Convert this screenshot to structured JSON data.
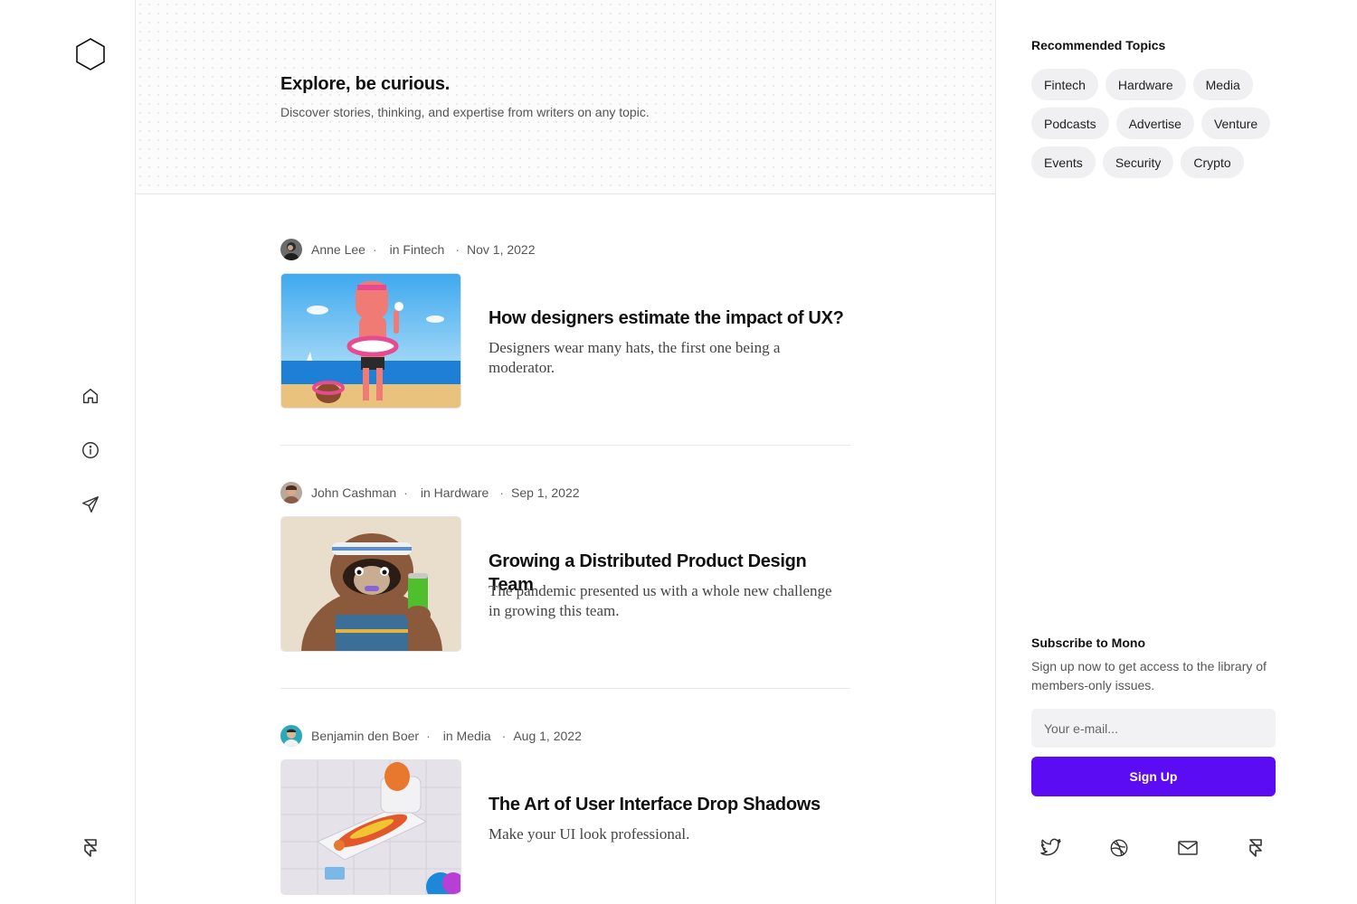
{
  "brand": {
    "logo_icon": "hexagon-icon"
  },
  "nav": [
    {
      "name": "home",
      "icon": "home-icon"
    },
    {
      "name": "about",
      "icon": "info-icon"
    },
    {
      "name": "send",
      "icon": "paper-plane-icon"
    }
  ],
  "footer_rail_icon": "framer-icon",
  "hero": {
    "title": "Explore, be curious.",
    "subtitle": "Discover stories, thinking, and expertise from writers on any topic."
  },
  "posts": [
    {
      "author": "Anne Lee",
      "topic": "in Fintech",
      "date": "Nov 1, 2022",
      "title": "How designers estimate the impact of UX?",
      "excerpt": "Designers wear many hats, the first one being a moderator."
    },
    {
      "author": "John Cashman",
      "topic": "in Hardware",
      "date": "Sep 1, 2022",
      "title": "Growing a Distributed Product Design Team",
      "excerpt": "The pandemic presented us with a whole new challenge in growing this team."
    },
    {
      "author": "Benjamin den Boer",
      "topic": "in Media",
      "date": "Aug 1, 2022",
      "title": "The Art of User Interface Drop Shadows",
      "excerpt": "Make your UI look professional."
    }
  ],
  "sep": "·",
  "topics": {
    "heading": "Recommended Topics",
    "items": [
      "Fintech",
      "Hardware",
      "Media",
      "Podcasts",
      "Advertise",
      "Venture",
      "Events",
      "Security",
      "Crypto"
    ]
  },
  "subscribe": {
    "heading": "Subscribe to Mono",
    "text": "Sign up now to get access to the library of members-only issues.",
    "email_placeholder": "Your e-mail...",
    "button": "Sign Up"
  },
  "social": [
    "twitter-icon",
    "dribbble-icon",
    "mail-icon",
    "framer-icon"
  ],
  "colors": {
    "accent": "#5b0cf2",
    "chip_bg": "#f0f0f2",
    "border": "#e8e8ea"
  }
}
